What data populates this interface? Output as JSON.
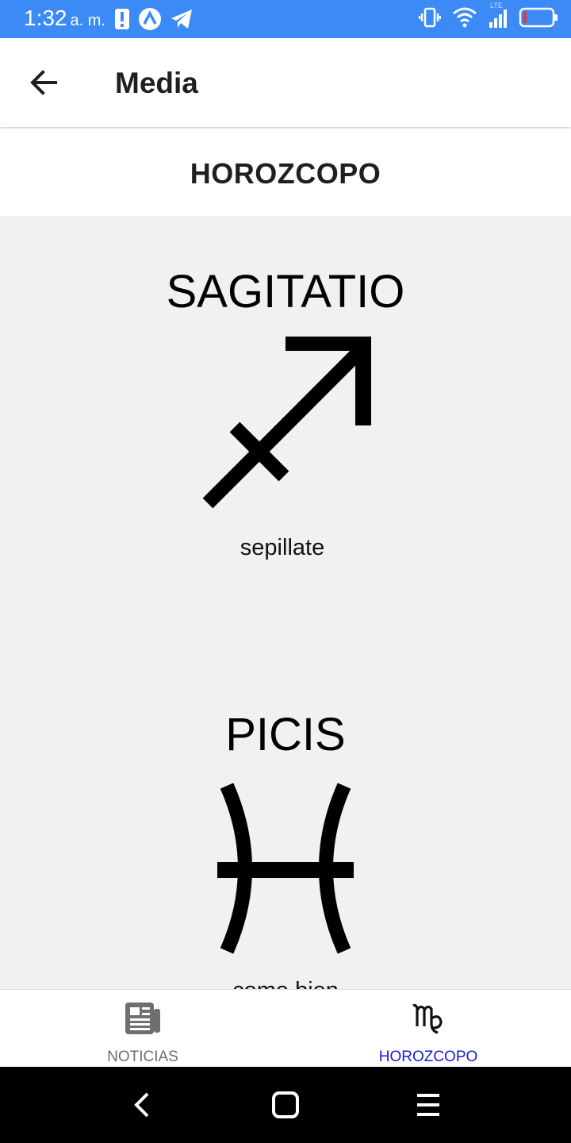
{
  "status_bar": {
    "time": "1:32",
    "ampm": "a. m.",
    "icons_left": [
      "alert-icon",
      "app-icon",
      "telegram-icon"
    ],
    "icons_right": [
      "vibrate-icon",
      "wifi-icon",
      "signal-lte-icon",
      "battery-low-icon"
    ],
    "network": "LTE"
  },
  "app_bar": {
    "title": "Media",
    "back_icon": "arrow-left-icon"
  },
  "section_header": "HOROZCOPO",
  "signs": [
    {
      "name": "SAGITATIO",
      "symbol": "sagittarius-icon",
      "description": "sepillate"
    },
    {
      "name": "PICIS",
      "symbol": "pisces-icon",
      "description": "come bien"
    }
  ],
  "bottom_nav": {
    "items": [
      {
        "label": "NOTICIAS",
        "icon": "newspaper-icon",
        "active": false
      },
      {
        "label": "HOROZCOPO",
        "icon": "virgo-icon",
        "active": true
      }
    ],
    "active_color": "#1a1ad6",
    "inactive_color": "#6f6f6f"
  },
  "colors": {
    "status_bar": "#3b8af5",
    "content_bg": "#f1f1f1"
  }
}
